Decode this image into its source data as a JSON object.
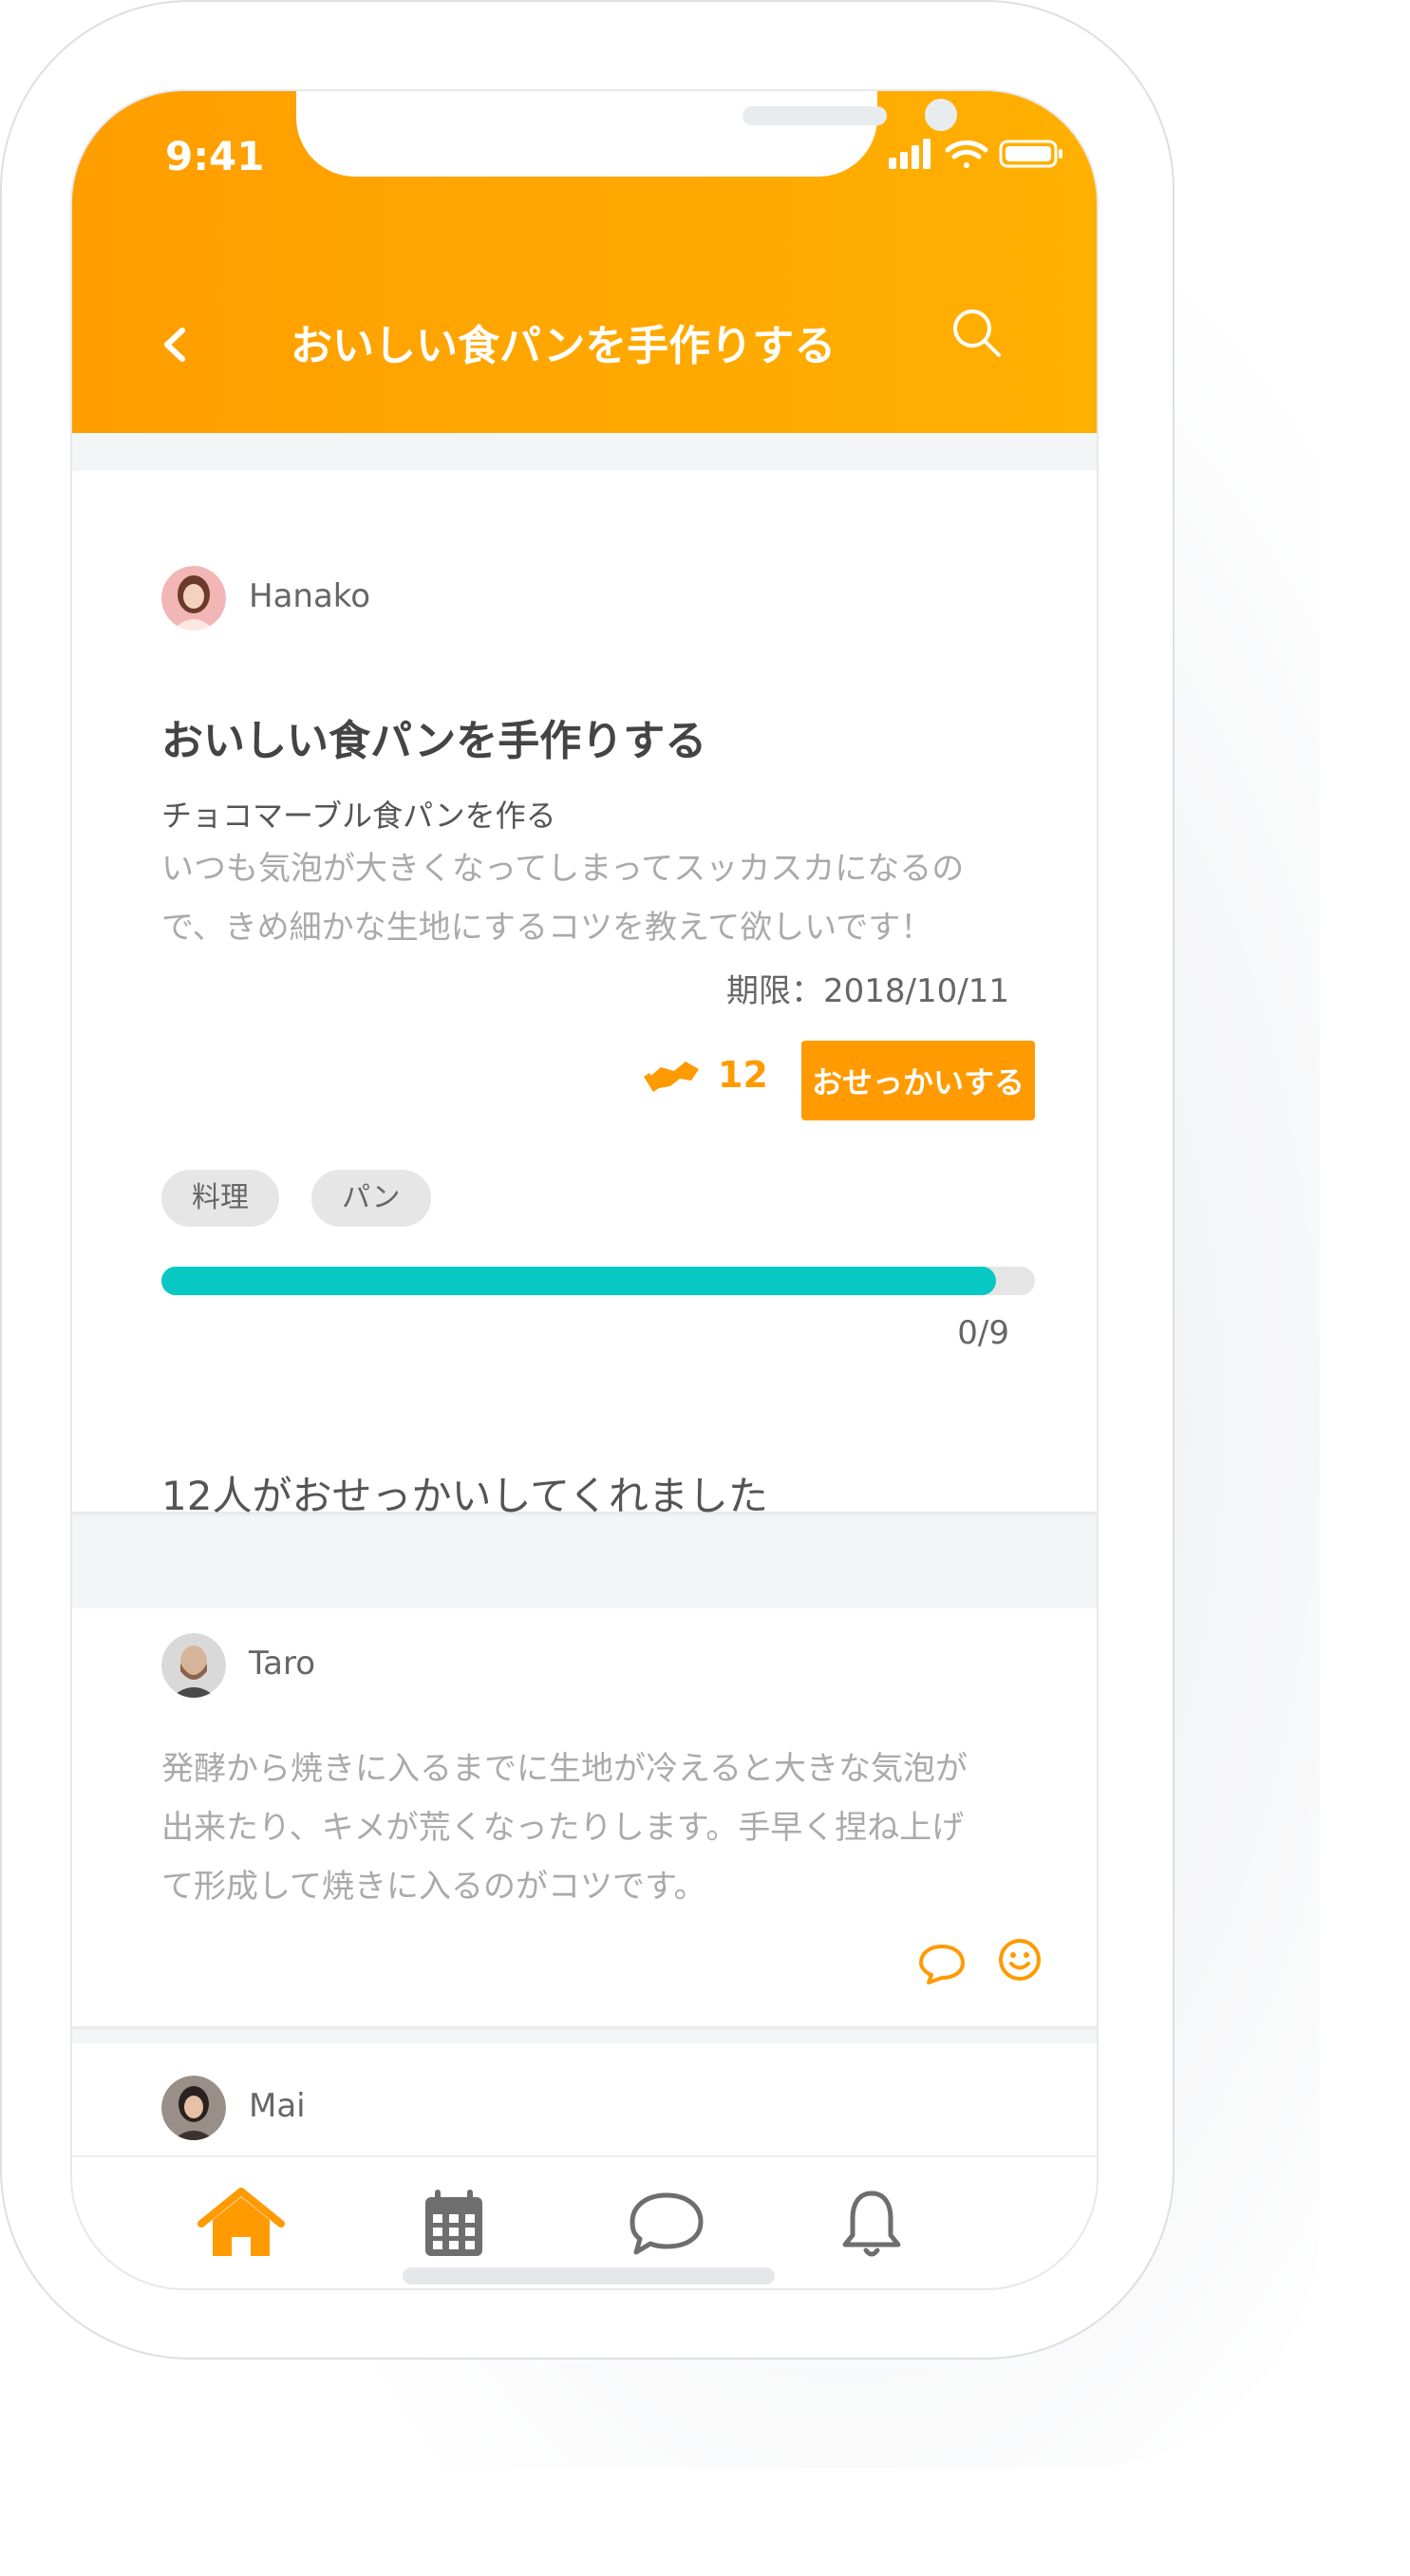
{
  "status_bar": {
    "time": "9:41"
  },
  "header": {
    "title": "おいしい食パンを手作りする"
  },
  "post": {
    "author": "Hanako",
    "title": "おいしい食パンを手作りする",
    "subtitle": "チョコマーブル食パンを作る",
    "description_lines": [
      "いつも気泡が大きくなってしまってスッカスカになるの",
      "で、きめ細かな生地にするコツを教えて欲しいです！"
    ],
    "deadline": "期限：2018/10/11",
    "osekkai_count": "12",
    "action_label": "おせっかいする",
    "tags": [
      "料理",
      "パン"
    ],
    "progress_text": "0/9",
    "progress_fraction": 0.955
  },
  "section": {
    "title": "12人がおせっかいしてくれました"
  },
  "comments": [
    {
      "author": "Taro",
      "lines": [
        "発酵から焼きに入るまでに生地が冷えると大きな気泡が",
        "出来たり、キメが荒くなったりします。手早く捏ね上げ",
        "て形成して焼きに入るのがコツです。"
      ]
    },
    {
      "author": "Mai"
    }
  ],
  "colors": {
    "accent": "#ff9a00",
    "progress": "#08c8c4"
  },
  "icons": {
    "back": "chevron-left-icon",
    "search": "search-icon",
    "reply": "speech-bubble-icon",
    "reaction": "smiley-icon",
    "tabs": [
      "home-icon",
      "calendar-icon",
      "chat-icon",
      "bell-icon"
    ]
  }
}
